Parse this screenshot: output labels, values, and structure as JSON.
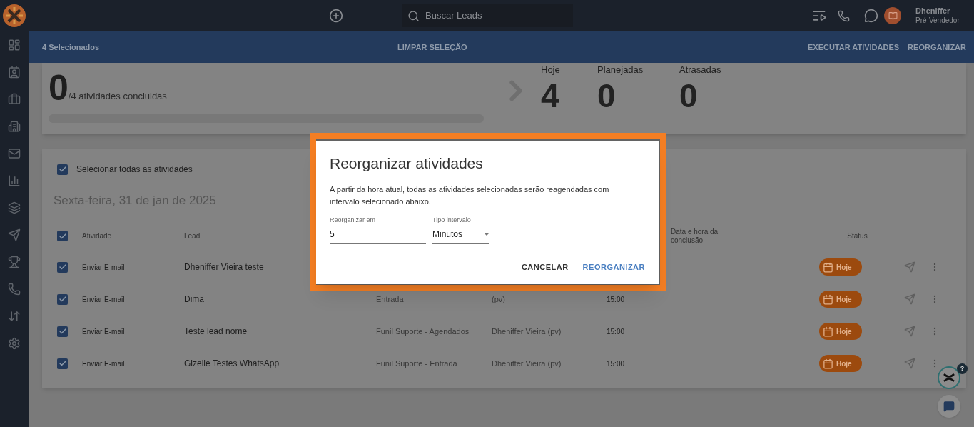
{
  "topbar": {
    "search": {
      "placeholder": "Buscar Leads"
    },
    "user": {
      "name": "Dheniffer",
      "role": "Pré-Vendedor"
    }
  },
  "selection_bar": {
    "count": "4 Selecionados",
    "clear": "LIMPAR SELEÇÃO",
    "actions": [
      "EXECUTAR ATIVIDADES",
      "REORGANIZAR"
    ]
  },
  "summary": {
    "done": "0",
    "total": "/4 atividades concluidas",
    "stats": [
      {
        "label": "Hoje",
        "value": "4"
      },
      {
        "label": "Planejadas",
        "value": "0"
      },
      {
        "label": "Atrasadas",
        "value": "0"
      }
    ]
  },
  "activities": {
    "select_all": {
      "label": "Selecionar todas as atividades",
      "checked": true
    },
    "date": "Sexta-feira, 31 de jan de 2025",
    "header_checked": true,
    "columns": {
      "activity": "Atividade",
      "lead": "Lead",
      "completed_at": "Data e hora da conclusão",
      "status": "Status"
    },
    "rows": [
      {
        "checked": true,
        "activity": "Enviar E-mail",
        "lead": "Dheniffer Vieira teste",
        "status": "Hoje"
      },
      {
        "checked": true,
        "activity": "Enviar E-mail",
        "lead": "Dima",
        "funnel": "Entrada",
        "owner": "(pv)",
        "time": "15:00",
        "status": "Hoje"
      },
      {
        "checked": true,
        "activity": "Enviar E-mail",
        "lead": "Teste lead nome",
        "funnel": "Funil Suporte - Agendados",
        "owner": "Dheniffer Vieira (pv)",
        "time": "15:00",
        "status": "Hoje"
      },
      {
        "checked": true,
        "activity": "Enviar E-mail",
        "lead": "Gizelle Testes WhatsApp",
        "funnel": "Funil Suporte - Entrada",
        "owner": "Dheniffer Vieira (pv)",
        "time": "15:00",
        "status": "Hoje"
      }
    ]
  },
  "dialog": {
    "title": "Reorganizar atividades",
    "text": "A partir da hora atual, todas as atividades selecionadas serão reagendadas com intervalo selecionado abaixo.",
    "amount": {
      "label": "Reorganizar em",
      "value": "5"
    },
    "interval": {
      "label": "Tipo intervalo",
      "value": "Minutos"
    },
    "buttons": [
      {
        "label": "CANCELAR",
        "kind": "secondary"
      },
      {
        "label": "REORGANIZAR",
        "kind": "primary"
      }
    ]
  },
  "help_badge": "?"
}
